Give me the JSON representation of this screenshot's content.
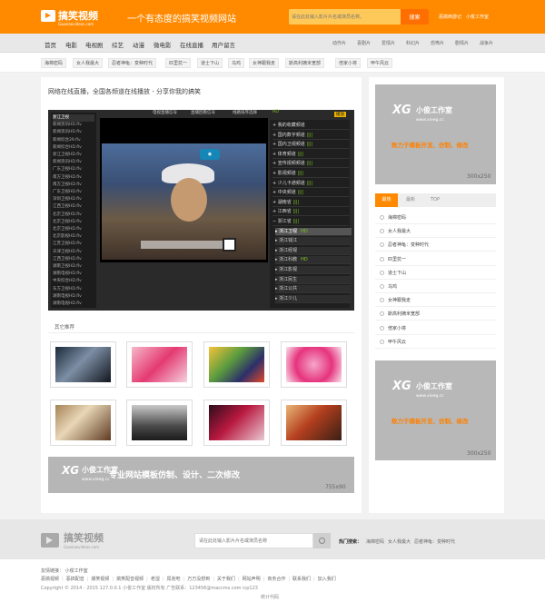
{
  "header": {
    "logo_title": "搞笑视频",
    "logo_sub": "Gaoxiaovideos.com",
    "slogan": "一个有态度的搞笑视频网站",
    "search_placeholder": "请在此处输入影片片名或演员名称。",
    "search_button": "搜索",
    "links": [
      "恶搞西游记",
      "小俊工作室"
    ]
  },
  "nav": {
    "left": [
      "首页",
      "电影",
      "电视剧",
      "综艺",
      "动漫",
      "微电影",
      "在线直播",
      "用户留言"
    ],
    "right": [
      "动作片",
      "喜剧片",
      "爱情片",
      "科幻片",
      "恐怖片",
      "剧情片",
      "战争片"
    ]
  },
  "tags": [
    "海棉密码",
    "女人我最大",
    "忍者神龟：变种时代",
    "匹里抗一",
    "道士下山",
    "乌鸡",
    "女神跟我走",
    "斯高利摘米宽部",
    "倍家小将",
    "甲午风云"
  ],
  "main": {
    "title": "网络在线直播，全国各频道在线播放 - 分享你我的搞笑",
    "player": {
      "head_tabs": [
        "电视直播信号",
        "直播回看信号",
        "线路排序选择"
      ],
      "hd_label": "HD",
      "play_btn": "播放",
      "playlist": [
        "浙江卫视",
        "新闻资讯HD.flv",
        "新闻资讯HD.flv",
        "新闻综合29.flv",
        "新闻综合HD.flv",
        "浙江卫视HD.flv",
        "新闻资讯HD.flv",
        "广东卫视HD.flv",
        "南方卫视HD.flv",
        "南方卫视HD.flv",
        "广东卫视HD.flv",
        "深圳卫视HD.flv",
        "江西卫视HD.flv",
        "北京卫视HD.flv",
        "北京卫视HD.flv",
        "北京卫视HD.flv",
        "北京影视HD.flv",
        "江苏卫视HD.flv",
        "天津卫视HD.flv",
        "江西卫视HD.flv",
        "湖南卫视HD.flv",
        "湖南电视HD.flv",
        "中央综合HD.flv",
        "东方卫视HD.flv",
        "湖南电视HD.flv",
        "湖南电视HD.flv"
      ],
      "channels": [
        {
          "label": "我的收藏频道",
          "type": "group"
        },
        {
          "label": "国内数字频道",
          "type": "group",
          "bars": true
        },
        {
          "label": "国内卫视频道",
          "type": "group",
          "bars": true
        },
        {
          "label": "体育频道",
          "type": "group",
          "bars": true
        },
        {
          "label": "宣传视频频道",
          "type": "group",
          "bars": true
        },
        {
          "label": "影视频道",
          "type": "group",
          "bars": true
        },
        {
          "label": "少儿卡通频道",
          "type": "group",
          "bars": true
        },
        {
          "label": "中央频道",
          "type": "group",
          "bars": true
        },
        {
          "label": "湖南省",
          "type": "group",
          "bars": true
        },
        {
          "label": "江西省",
          "type": "group",
          "bars": true
        },
        {
          "label": "浙江省",
          "type": "group",
          "bars": true
        },
        {
          "label": "浙江卫视",
          "type": "sub",
          "hd": true,
          "selected": true
        },
        {
          "label": "浙江钱江",
          "type": "sub"
        },
        {
          "label": "浙江经视",
          "type": "sub"
        },
        {
          "label": "浙江科教",
          "type": "sub",
          "hd": true
        },
        {
          "label": "浙江影视",
          "type": "sub"
        },
        {
          "label": "浙江民生",
          "type": "sub"
        },
        {
          "label": "浙江公共",
          "type": "sub"
        },
        {
          "label": "浙江少儿",
          "type": "sub"
        }
      ]
    },
    "recommend_title": "其它推荐",
    "banner": {
      "brand": "小俊工作室",
      "url": "www.xieeg.cc",
      "text": "专业网站模板仿制、设计、二次修改",
      "size": "755x90"
    }
  },
  "sidebar": {
    "ad_brand": "小俊工作室",
    "ad_url": "www.xieeg.cc",
    "ad_slogan": "致力于模板开发、仿制、修改",
    "ad_size": "300x250",
    "rank_tabs": [
      "最热",
      "最新",
      "TOP"
    ],
    "ranking": [
      "海棉密码",
      "女人我最大",
      "忍者神龟：变种时代",
      "匹里抗一",
      "道士下山",
      "乌鸡",
      "女神跟我走",
      "斯高利摘米宽部",
      "倍家小将",
      "甲午风云"
    ]
  },
  "footer": {
    "logo_title": "搞笑视频",
    "logo_sub": "Gaoxiaovideos.com",
    "search_placeholder": "请在此处输入影片片名或演员名称",
    "hot_label": "热门搜索：",
    "hot_links": [
      "海棉密码",
      "女人我最大",
      "忍者神龟：变种时代"
    ],
    "friends": "友情链接： 小俊工作室",
    "links": [
      "恶搞视频",
      "恶搞配音",
      "爆笑视频",
      "搞笑配音视频",
      "老湿",
      "屌逝吧",
      "万万没想到",
      "关于我们",
      "网站声明",
      "商务合作",
      "联系我们",
      "加入我们"
    ],
    "copyright": "Copyright © 2014 - 2015 127.0.0.1 小俊工作室 版权所有 广告联系：123456@maccms.com icp123",
    "stat": "统计代码"
  },
  "colors": {
    "brand": "#ff8a00",
    "accent": "#ff6e00",
    "hd": "#7ec621"
  }
}
